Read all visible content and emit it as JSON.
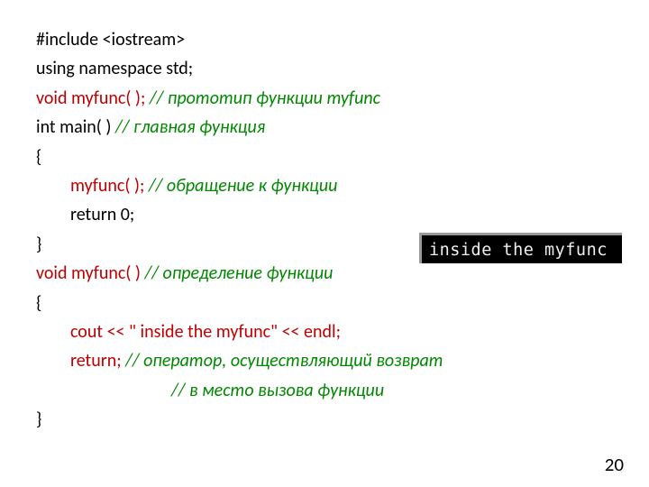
{
  "code": {
    "l1a": "#include <iostream>",
    "l2a": "using namespace std;",
    "l3a": "void myfunc( );",
    "l3b": " // прототип функции myfunc",
    "l4a": "int main( ) ",
    "l4b": "// главная функция",
    "l5a": "{",
    "l6a": "myfunc( );",
    "l6b": "  // обращение к функции",
    "l7a": "return 0;",
    "l8a": "}",
    "l9a": "void myfunc( ) ",
    "l9b": "// определение функции",
    "l10a": "{",
    "l11a": "cout << \" inside the myfunc\" << endl;",
    "l12a": "return;",
    "l12b": "       // оператор, осуществляющий возврат",
    "l13b": "// в место вызова функции",
    "l14a": "}"
  },
  "console": {
    "output": " inside the myfunc"
  },
  "page": {
    "number": "20"
  }
}
